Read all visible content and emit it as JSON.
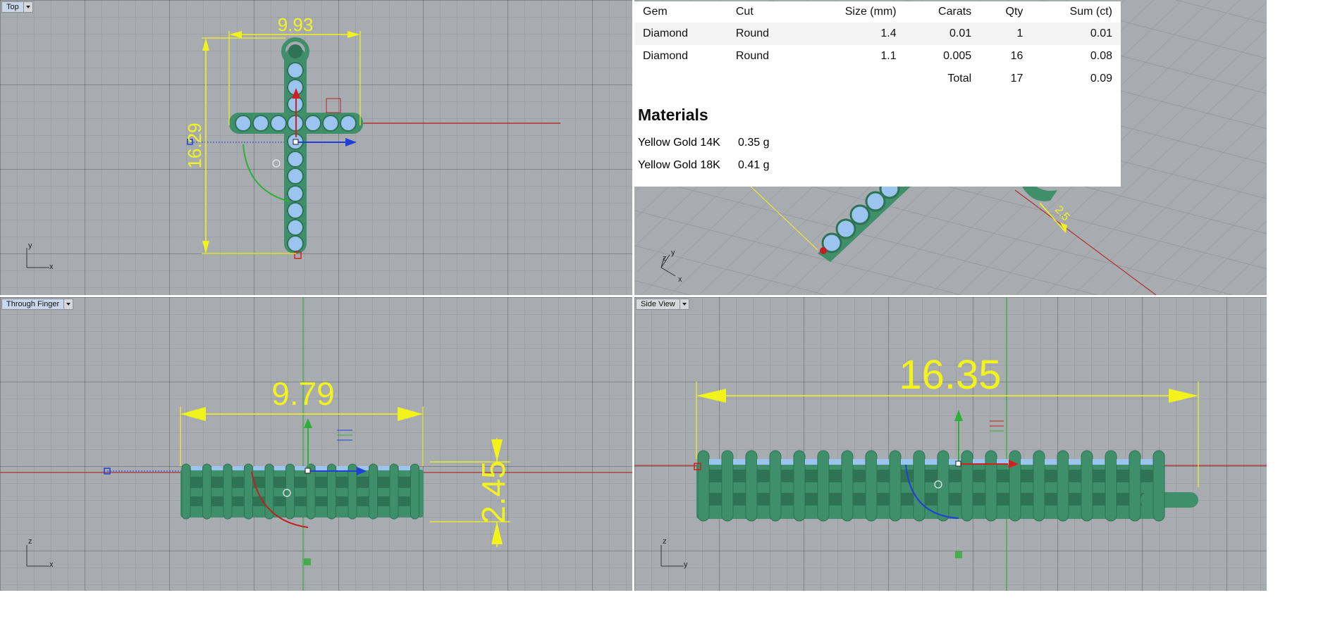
{
  "viewports": {
    "top": {
      "label": "Top",
      "dims": {
        "width": "9.93",
        "height": "16.29"
      },
      "axes": {
        "v": "y",
        "h": "x"
      }
    },
    "perspective": {
      "axes": {
        "v": "y",
        "z": "z",
        "h": "x"
      },
      "dim": "2.5"
    },
    "front": {
      "label": "Through Finger",
      "dims": {
        "width": "9.79",
        "height": "2.45"
      },
      "axes": {
        "v": "z",
        "h": "x"
      }
    },
    "side": {
      "label": "Side View",
      "dims": {
        "length": "16.35"
      },
      "axes": {
        "v": "z",
        "h": "y"
      }
    }
  },
  "report": {
    "gems": {
      "headers": [
        "Gem",
        "Cut",
        "Size (mm)",
        "Carats",
        "Qty",
        "Sum (ct)"
      ],
      "rows": [
        [
          "Diamond",
          "Round",
          "1.4",
          "0.01",
          "1",
          "0.01"
        ],
        [
          "Diamond",
          "Round",
          "1.1",
          "0.005",
          "16",
          "0.08"
        ]
      ],
      "total": {
        "label": "Total",
        "qty": "17",
        "sum": "0.09"
      }
    },
    "materials": {
      "title": "Materials",
      "items": [
        {
          "name": "Yellow Gold 14K",
          "weight": "0.35 g"
        },
        {
          "name": "Yellow Gold 18K",
          "weight": "0.41 g"
        }
      ]
    }
  },
  "colors": {
    "viewport_bg": "#a8acb1",
    "metal": "#3f8f6a",
    "gem": "#9cc4f0",
    "dimension": "#f3f31c",
    "x_axis": "#b03030",
    "y_axis": "#2fae3a",
    "gumball_z": "#1f3fd8"
  }
}
